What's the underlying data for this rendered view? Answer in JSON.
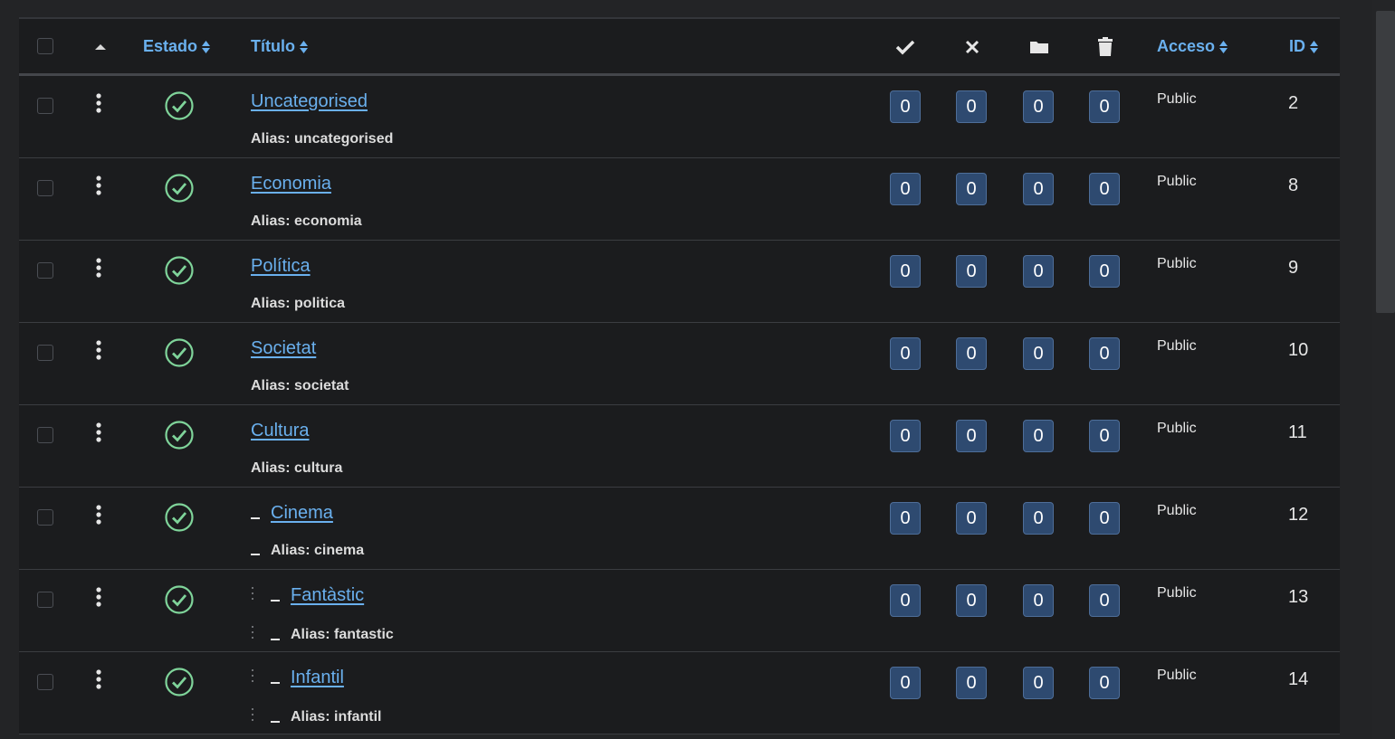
{
  "header": {
    "estado": "Estado",
    "titulo": "Título",
    "acceso": "Acceso",
    "id": "ID",
    "icons": [
      "check-icon",
      "times-icon",
      "folder-icon",
      "trash-icon"
    ]
  },
  "colors": {
    "link": "#6ab0ee",
    "badge_bg": "#2e4a70",
    "published": "#7fd49a",
    "background": "#1b1c1e"
  },
  "rows": [
    {
      "title": "Uncategorised",
      "alias": "Alias: uncategorised",
      "counts": [
        "0",
        "0",
        "0",
        "0"
      ],
      "access": "Public",
      "id": "2"
    },
    {
      "title": "Economia",
      "alias": "Alias: economia",
      "counts": [
        "0",
        "0",
        "0",
        "0"
      ],
      "access": "Public",
      "id": "8"
    },
    {
      "title": "Política",
      "alias": "Alias: politica",
      "counts": [
        "0",
        "0",
        "0",
        "0"
      ],
      "access": "Public",
      "id": "9"
    },
    {
      "title": "Societat",
      "alias": "Alias: societat",
      "counts": [
        "0",
        "0",
        "0",
        "0"
      ],
      "access": "Public",
      "id": "10"
    },
    {
      "title": "Cultura",
      "alias": "Alias: cultura",
      "counts": [
        "0",
        "0",
        "0",
        "0"
      ],
      "access": "Public",
      "id": "11"
    },
    {
      "title": "Cinema",
      "alias": "Alias: cinema",
      "counts": [
        "0",
        "0",
        "0",
        "0"
      ],
      "access": "Public",
      "id": "12"
    },
    {
      "title": "Fantàstic",
      "alias": "Alias: fantastic",
      "counts": [
        "0",
        "0",
        "0",
        "0"
      ],
      "access": "Public",
      "id": "13"
    },
    {
      "title": "Infantil",
      "alias": "Alias: infantil",
      "counts": [
        "0",
        "0",
        "0",
        "0"
      ],
      "access": "Public",
      "id": "14"
    }
  ]
}
